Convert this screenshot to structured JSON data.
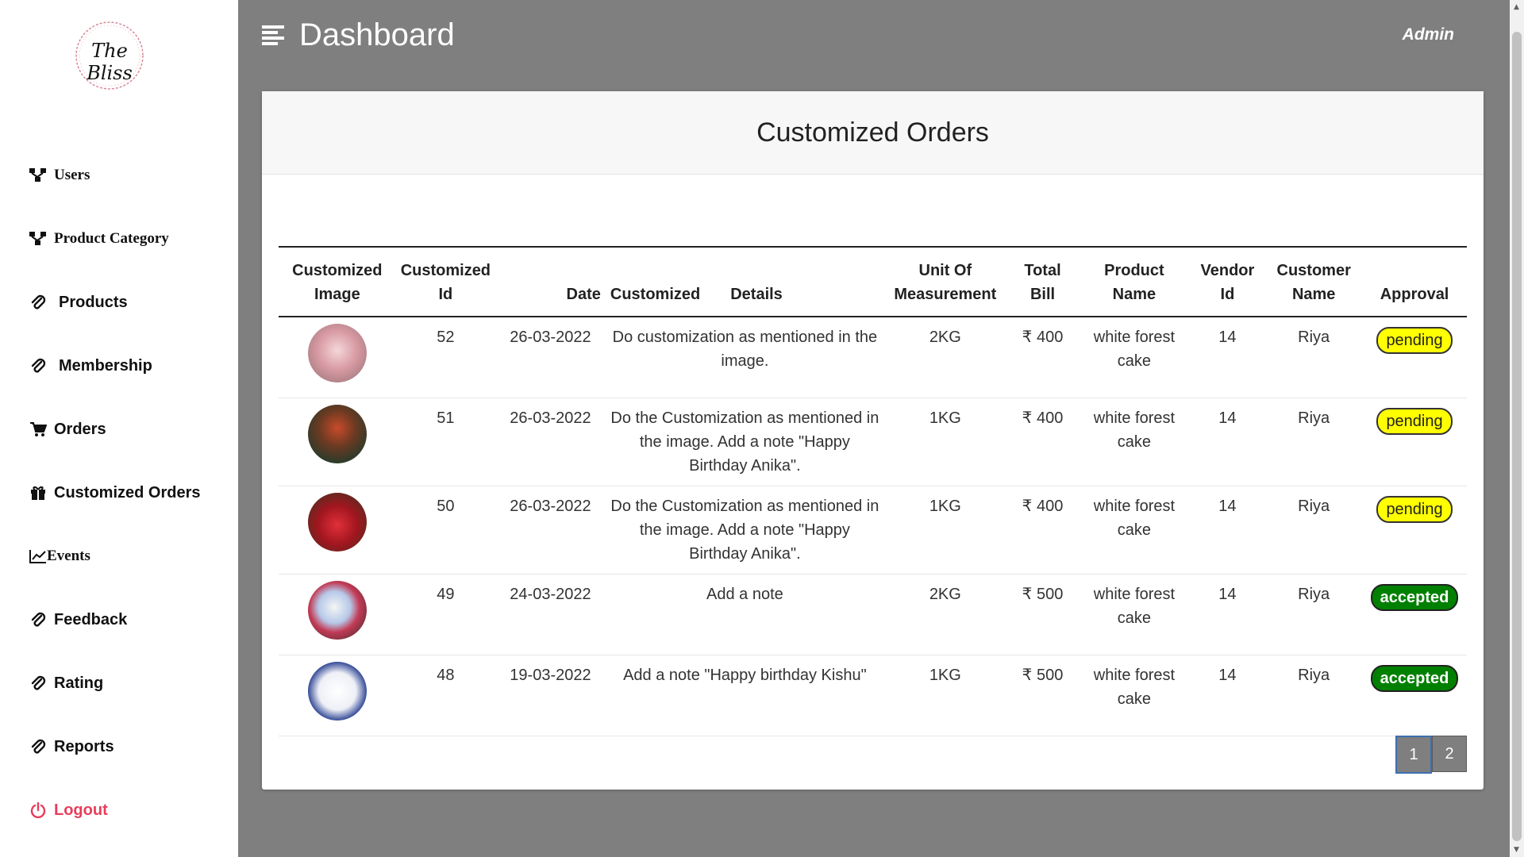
{
  "app": {
    "logo_text": "The Bliss",
    "title": "Dashboard",
    "user": "Admin"
  },
  "sidebar": {
    "items": [
      {
        "label": "Users",
        "icon": "sitemap-icon"
      },
      {
        "label": "Product Category",
        "icon": "sitemap-icon"
      },
      {
        "label": "Products",
        "icon": "paperclip-icon"
      },
      {
        "label": "Membership",
        "icon": "paperclip-icon"
      },
      {
        "label": "Orders",
        "icon": "cart-icon"
      },
      {
        "label": "Customized Orders",
        "icon": "gift-icon"
      },
      {
        "label": "Events",
        "icon": "chart-line-icon"
      },
      {
        "label": "Feedback",
        "icon": "paperclip-icon"
      },
      {
        "label": "Rating",
        "icon": "paperclip-icon"
      },
      {
        "label": "Reports",
        "icon": "paperclip-icon"
      },
      {
        "label": "Logout",
        "icon": "power-icon"
      }
    ]
  },
  "card": {
    "title": "Customized Orders"
  },
  "table": {
    "headers": {
      "image": [
        "Customized",
        "Image"
      ],
      "id": [
        "Customized",
        "Id"
      ],
      "date": "Date",
      "customized": "Customized",
      "details": "Details",
      "unit": [
        "Unit Of",
        "Measurement"
      ],
      "bill": [
        "Total",
        "Bill"
      ],
      "product": [
        "Product",
        "Name"
      ],
      "vendor": [
        "Vendor",
        "Id"
      ],
      "customer": [
        "Customer",
        "Name"
      ],
      "approval": "Approval"
    },
    "rows": [
      {
        "id": "52",
        "date": "26-03-2022",
        "details": "Do customization as mentioned in the image.",
        "unit": "2KG",
        "bill": "₹ 400",
        "product": "white forest cake",
        "vendor": "14",
        "customer": "Riya",
        "approval": "pending"
      },
      {
        "id": "51",
        "date": "26-03-2022",
        "details": "Do the Customization as mentioned in the image. Add a note \"Happy Birthday Anika\".",
        "unit": "1KG",
        "bill": "₹ 400",
        "product": "white forest cake",
        "vendor": "14",
        "customer": "Riya",
        "approval": "pending"
      },
      {
        "id": "50",
        "date": "26-03-2022",
        "details": "Do the Customization as mentioned in the image. Add a note \"Happy Birthday Anika\".",
        "unit": "1KG",
        "bill": "₹ 400",
        "product": "white forest cake",
        "vendor": "14",
        "customer": "Riya",
        "approval": "pending"
      },
      {
        "id": "49",
        "date": "24-03-2022",
        "details": "Add a note",
        "unit": "2KG",
        "bill": "₹ 500",
        "product": "white forest cake",
        "vendor": "14",
        "customer": "Riya",
        "approval": "accepted"
      },
      {
        "id": "48",
        "date": "19-03-2022",
        "details": "Add a note \"Happy birthday Kishu\"",
        "unit": "1KG",
        "bill": "₹ 500",
        "product": "white forest cake",
        "vendor": "14",
        "customer": "Riya",
        "approval": "accepted"
      }
    ]
  },
  "pagination": {
    "pages": [
      "1",
      "2"
    ],
    "current": "1"
  },
  "colors": {
    "pending": "#ffff00",
    "accepted": "#008000",
    "logout": "#e83e5c",
    "background": "#7f7f7f"
  }
}
